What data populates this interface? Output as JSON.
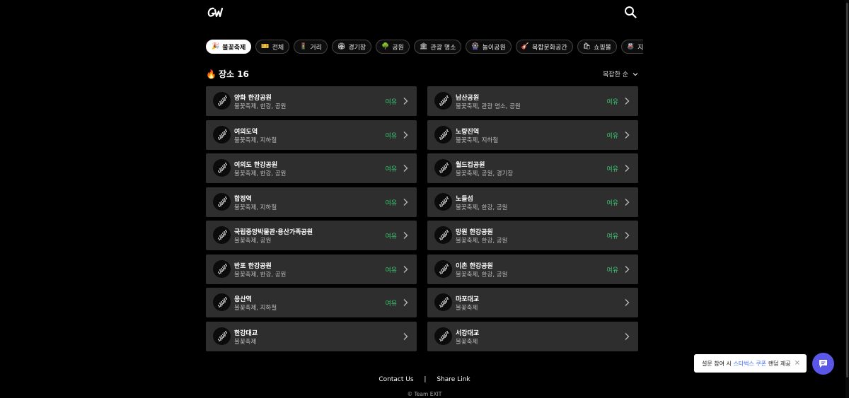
{
  "header": {
    "logo_label": "GW",
    "search_icon": "search-icon"
  },
  "categories": [
    {
      "emoji": "🎉",
      "label": "불꽃축제",
      "active": true
    },
    {
      "emoji": "🎫",
      "label": "전체"
    },
    {
      "emoji": "🚦",
      "label": "거리"
    },
    {
      "emoji": "🏟",
      "label": "경기장"
    },
    {
      "emoji": "🌳",
      "label": "공원"
    },
    {
      "emoji": "🏛",
      "label": "관광 명소"
    },
    {
      "emoji": "🎡",
      "label": "놀이공원"
    },
    {
      "emoji": "🎸",
      "label": "복합문화공간"
    },
    {
      "emoji": "🛍",
      "label": "쇼핑몰"
    },
    {
      "emoji": "🚇",
      "label": "지하철"
    },
    {
      "emoji": "🎭",
      "label": ""
    }
  ],
  "summary": {
    "icon": "🔥",
    "label": "장소 16"
  },
  "sort": {
    "label": "복잡한 순"
  },
  "places": [
    {
      "name": "양화 한강공원",
      "tags": "불꽃축제, 한강, 공원",
      "status": "여유"
    },
    {
      "name": "남산공원",
      "tags": "불꽃축제, 관광 명소, 공원",
      "status": "여유"
    },
    {
      "name": "여의도역",
      "tags": "불꽃축제, 지하철",
      "status": "여유"
    },
    {
      "name": "노량진역",
      "tags": "불꽃축제, 지하철",
      "status": "여유"
    },
    {
      "name": "여의도 한강공원",
      "tags": "불꽃축제, 한강, 공원",
      "status": "여유"
    },
    {
      "name": "월드컵공원",
      "tags": "불꽃축제, 공원, 경기장",
      "status": "여유"
    },
    {
      "name": "합정역",
      "tags": "불꽃축제, 지하철",
      "status": "여유"
    },
    {
      "name": "노들섬",
      "tags": "불꽃축제, 한강, 공원",
      "status": "여유"
    },
    {
      "name": "국립중앙박물관·용산가족공원",
      "tags": "불꽃축제, 공원",
      "status": "여유"
    },
    {
      "name": "망원 한강공원",
      "tags": "불꽃축제, 한강, 공원",
      "status": "여유"
    },
    {
      "name": "반포 한강공원",
      "tags": "불꽃축제, 한강, 공원",
      "status": "여유"
    },
    {
      "name": "이촌 한강공원",
      "tags": "불꽃축제, 한강, 공원",
      "status": "여유"
    },
    {
      "name": "용산역",
      "tags": "불꽃축제, 지하철",
      "status": "여유"
    },
    {
      "name": "마포대교",
      "tags": "불꽃축제",
      "status": ""
    },
    {
      "name": "한강대교",
      "tags": "불꽃축제",
      "status": ""
    },
    {
      "name": "서강대교",
      "tags": "불꽃축제",
      "status": ""
    }
  ],
  "footer": {
    "contact": "Contact Us",
    "separator": "|",
    "share": "Share Link",
    "copyright": "© Team EXIT"
  },
  "toast": {
    "prefix": "설문 참여 시 ",
    "highlight": "스타벅스 쿠폰",
    "suffix": " 랜덤 제공",
    "close": "×"
  },
  "colors": {
    "background": "#000000",
    "card": "#2e2e2e",
    "status_ok": "#39c46d",
    "fab": "#5a57e8",
    "highlight": "#3b6cf6"
  }
}
